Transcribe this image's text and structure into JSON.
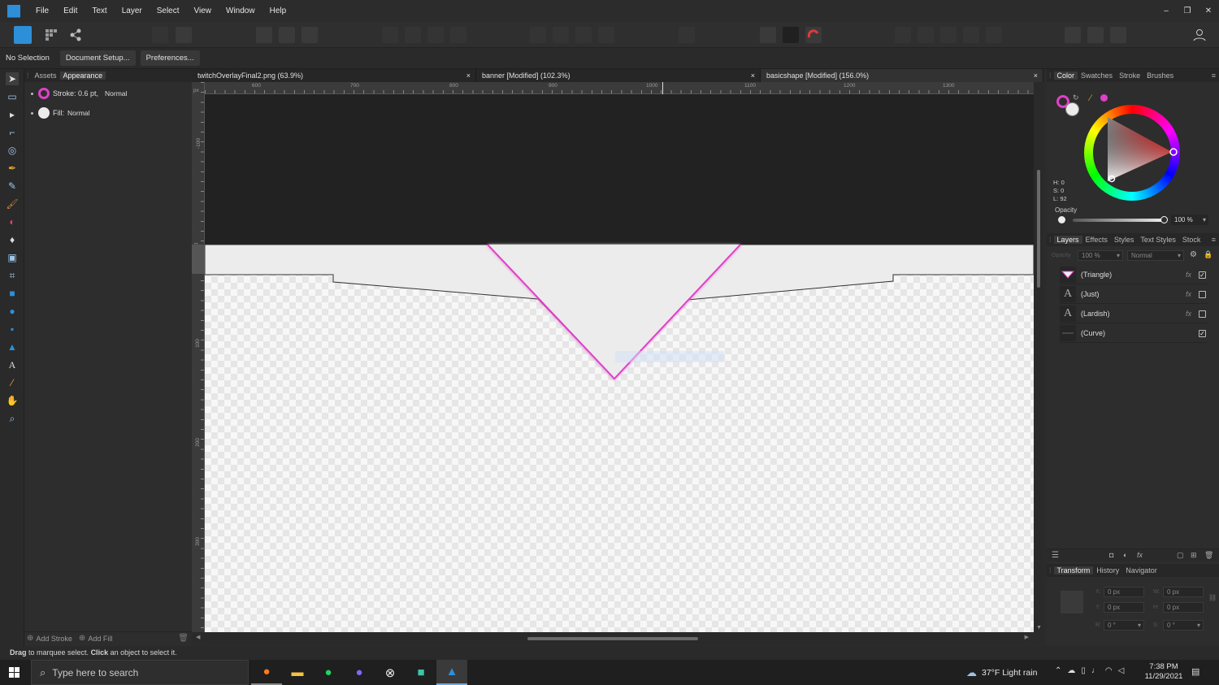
{
  "menubar": {
    "items": [
      "File",
      "Edit",
      "Text",
      "Layer",
      "Select",
      "View",
      "Window",
      "Help"
    ]
  },
  "window_controls": [
    "–",
    "❐",
    "✕"
  ],
  "context_bar": {
    "selection": "No Selection",
    "document_setup": "Document Setup...",
    "preferences": "Preferences..."
  },
  "left_panel": {
    "tabs": [
      "Assets",
      "Appearance"
    ],
    "active_tab": "Appearance",
    "stroke_label": "Stroke: 0.6 pt,",
    "stroke_blend": "Normal",
    "fill_label": "Fill:",
    "fill_blend": "Normal",
    "add_stroke": "Add Stroke",
    "add_fill": "Add Fill"
  },
  "doc_tabs": [
    {
      "title": "twitchOverlayFinal2.png (63.9%)",
      "close": "×"
    },
    {
      "title": "banner [Modified] (102.3%)",
      "close": "×"
    },
    {
      "title": "basicshape [Modified] (156.0%)",
      "close": "×"
    }
  ],
  "ruler": {
    "unit": "px",
    "h_labels": [
      "600",
      "700",
      "800",
      "900",
      "1000",
      "1100",
      "1200",
      "1300"
    ],
    "v_labels": [
      "-100",
      "0",
      "100",
      "200",
      "300"
    ]
  },
  "color_panel": {
    "tabs": [
      "Color",
      "Swatches",
      "Stroke",
      "Brushes"
    ],
    "h": "H: 0",
    "s": "S: 0",
    "l": "L: 92",
    "opacity_label": "Opacity",
    "opacity_value": "100 %",
    "accent": "#e040c8"
  },
  "layers_panel": {
    "tabs": [
      "Layers",
      "Effects",
      "Styles",
      "Text Styles",
      "Stock"
    ],
    "opacity_label": "Opacity",
    "opacity_value": "100 %",
    "blend": "Normal",
    "layers": [
      {
        "name": "(Triangle)",
        "fx": "fx",
        "checked": "✓",
        "thumb": ""
      },
      {
        "name": "(Just)",
        "fx": "fx",
        "checked": "",
        "thumb": "A"
      },
      {
        "name": "(Lardish)",
        "fx": "fx",
        "checked": "",
        "thumb": "A"
      },
      {
        "name": "(Curve)",
        "fx": "",
        "checked": "✓",
        "thumb": ""
      }
    ]
  },
  "transform_panel": {
    "tabs": [
      "Transform",
      "History",
      "Navigator"
    ],
    "x_label": "X:",
    "x": "0 px",
    "y_label": "Y:",
    "y": "0 px",
    "w_label": "W:",
    "w": "0 px",
    "h_label": "H:",
    "h": "0 px",
    "r_label": "R:",
    "r": "0 °",
    "s_label": "S:",
    "s": "0 °"
  },
  "status": {
    "drag": "Drag",
    "text1": " to marquee select. ",
    "click": "Click",
    "text2": " an object to select it."
  },
  "taskbar": {
    "search_placeholder": "Type here to search",
    "weather": "37°F  Light rain",
    "time": "7:38 PM",
    "date": "11/29/2021"
  }
}
